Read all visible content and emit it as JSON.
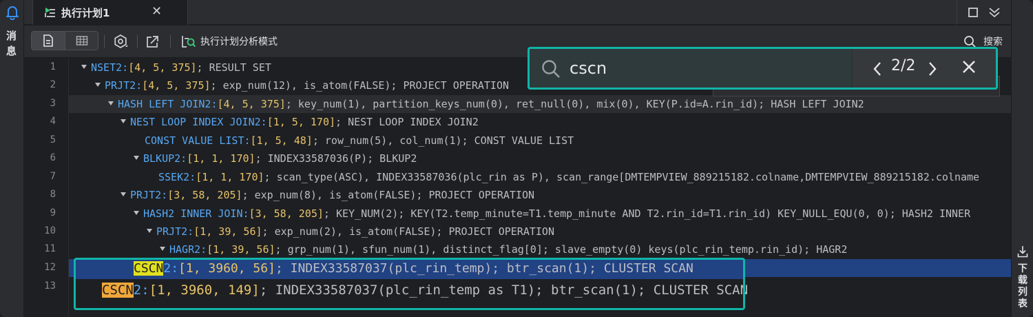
{
  "sidebar_left": {
    "label": "消息"
  },
  "sidebar_right": {
    "label": "下载列表"
  },
  "tab": {
    "title": "执行计划1"
  },
  "toolbar": {
    "mode_label": "执行计划分析模式",
    "search_label": "搜索"
  },
  "search": {
    "value": "cscn",
    "match_count": "2/2"
  },
  "colors": {
    "accent": "#10b5a8",
    "selection": "#214283",
    "name": "#56a8f5",
    "bracket": "#e8c46a"
  },
  "lines": [
    {
      "num": "1",
      "caret": true,
      "name": "NSET2:",
      "bracket": "[4, 5, 375]",
      "rest": "; RESULT SET"
    },
    {
      "num": "2",
      "caret": true,
      "name": "PRJT2:",
      "bracket": "[4, 5, 375]",
      "rest": "; exp_num(12), is_atom(FALSE); PROJECT OPERATION"
    },
    {
      "num": "3",
      "caret": true,
      "name": "HASH LEFT JOIN2:",
      "bracket": "[4, 5, 375]",
      "rest": "; key_num(1), partition_keys_num(0), ret_null(0), mix(0), KEY(P.id=A.rin_id); HASH LEFT JOIN2"
    },
    {
      "num": "4",
      "caret": true,
      "name": "NEST LOOP INDEX JOIN2:",
      "bracket": "[1, 5, 170]",
      "rest": "; NEST LOOP INDEX JOIN2"
    },
    {
      "num": "5",
      "caret": false,
      "name": "CONST VALUE LIST:",
      "bracket": "[1, 5, 48]",
      "rest": "; row_num(5), col_num(1); CONST VALUE LIST"
    },
    {
      "num": "6",
      "caret": true,
      "name": "BLKUP2:",
      "bracket": "[1, 1, 170]",
      "rest": "; INDEX33587036(P); BLKUP2"
    },
    {
      "num": "7",
      "caret": false,
      "name": "SSEK2:",
      "bracket": "[1, 1, 170]",
      "rest": "; scan_type(ASC), INDEX33587036(plc_rin as P), scan_range[DMTEMPVIEW_889215182.colname,DMTEMPVIEW_889215182.colname"
    },
    {
      "num": "8",
      "caret": true,
      "name": "PRJT2:",
      "bracket": "[3, 58, 205]",
      "rest": "; exp_num(8), is_atom(FALSE); PROJECT OPERATION"
    },
    {
      "num": "9",
      "caret": true,
      "name": "HASH2 INNER JOIN:",
      "bracket": "[3, 58, 205]",
      "rest": "; KEY_NUM(2); KEY(T2.temp_minute=T1.temp_minute AND T2.rin_id=T1.rin_id) KEY_NULL_EQU(0, 0); HASH2 INNER"
    },
    {
      "num": "10",
      "caret": true,
      "name": "PRJT2:",
      "bracket": "[1, 39, 56]",
      "rest": "; exp_num(2), is_atom(FALSE); PROJECT OPERATION"
    },
    {
      "num": "11",
      "caret": true,
      "name": "HAGR2:",
      "bracket": "[1, 39, 56]",
      "rest": "; grp_num(1), sfun_num(1), distinct_flag[0]; slave_empty(0) keys(plc_rin_temp.rin_id); HAGR2"
    },
    {
      "num": "12",
      "caret": false,
      "name_match": "CSCN",
      "name": "2:",
      "bracket": "[1, 3960, 56]",
      "rest": "; INDEX33587037(plc_rin_temp); btr_scan(1); CLUSTER SCAN"
    },
    {
      "num": "13",
      "caret": false,
      "name_match": "CSCN",
      "name": "2:",
      "bracket": "[1, 3960, 149]",
      "rest": "; INDEX33587037(plc_rin_temp as T1); btr_scan(1); CLUSTER SCAN"
    }
  ]
}
